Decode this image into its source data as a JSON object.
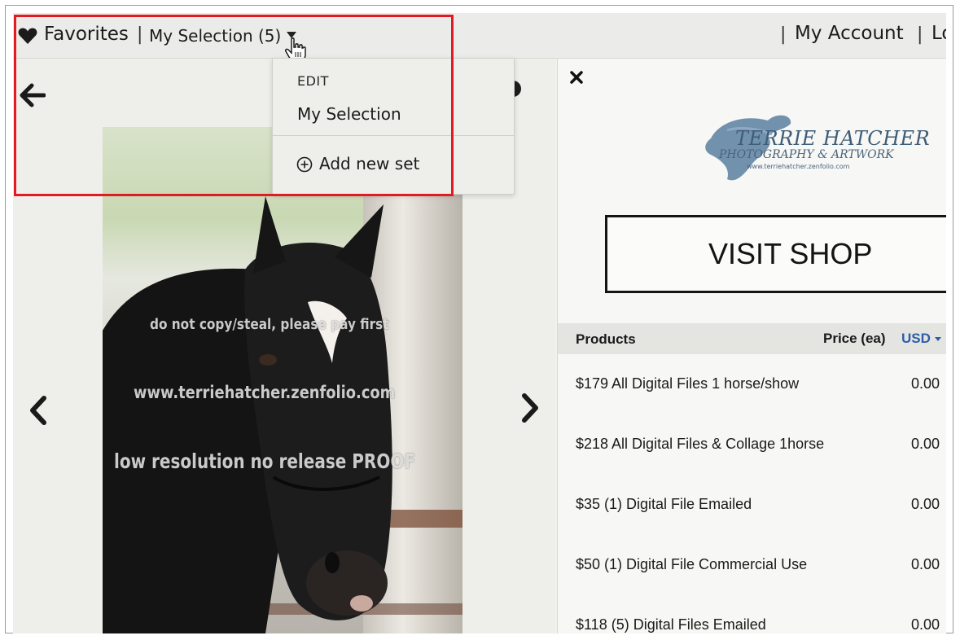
{
  "topbar": {
    "favorites_label": "Favorites",
    "separator": "|",
    "selection_label": "My Selection (5)",
    "account_label": "My Account",
    "login_label_partial": "Lo"
  },
  "dropdown": {
    "edit_label": "EDIT",
    "selection_item": "My Selection",
    "add_new_set_label": "Add new set"
  },
  "viewer": {
    "watermark_line1": "do not copy/steal, please pay first",
    "watermark_line2": "www.terriehatcher.zenfolio.com",
    "watermark_line3": "low resolution no release PROOF"
  },
  "panel": {
    "logo": {
      "line1": "TERRIE HATCHER",
      "line2": "PHOTOGRAPHY & ARTWORK",
      "line3": "www.terriehatcher.zenfolio.com"
    },
    "shop_button_label": "VISIT SHOP",
    "table": {
      "headers": {
        "products": "Products",
        "price": "Price (ea)",
        "currency": "USD"
      },
      "rows": [
        {
          "name": "$179 All Digital Files 1 horse/show",
          "price": "0.00"
        },
        {
          "name": "$218 All Digital Files & Collage 1horse",
          "price": "0.00"
        },
        {
          "name": "$35 (1) Digital File Emailed",
          "price": "0.00"
        },
        {
          "name": "$50 (1) Digital File Commercial Use",
          "price": "0.00"
        },
        {
          "name": "$118 (5) Digital Files Emailed",
          "price": "0.00"
        }
      ]
    }
  },
  "colors": {
    "highlight_border": "#e01b24",
    "currency_link": "#2d5fa8"
  }
}
